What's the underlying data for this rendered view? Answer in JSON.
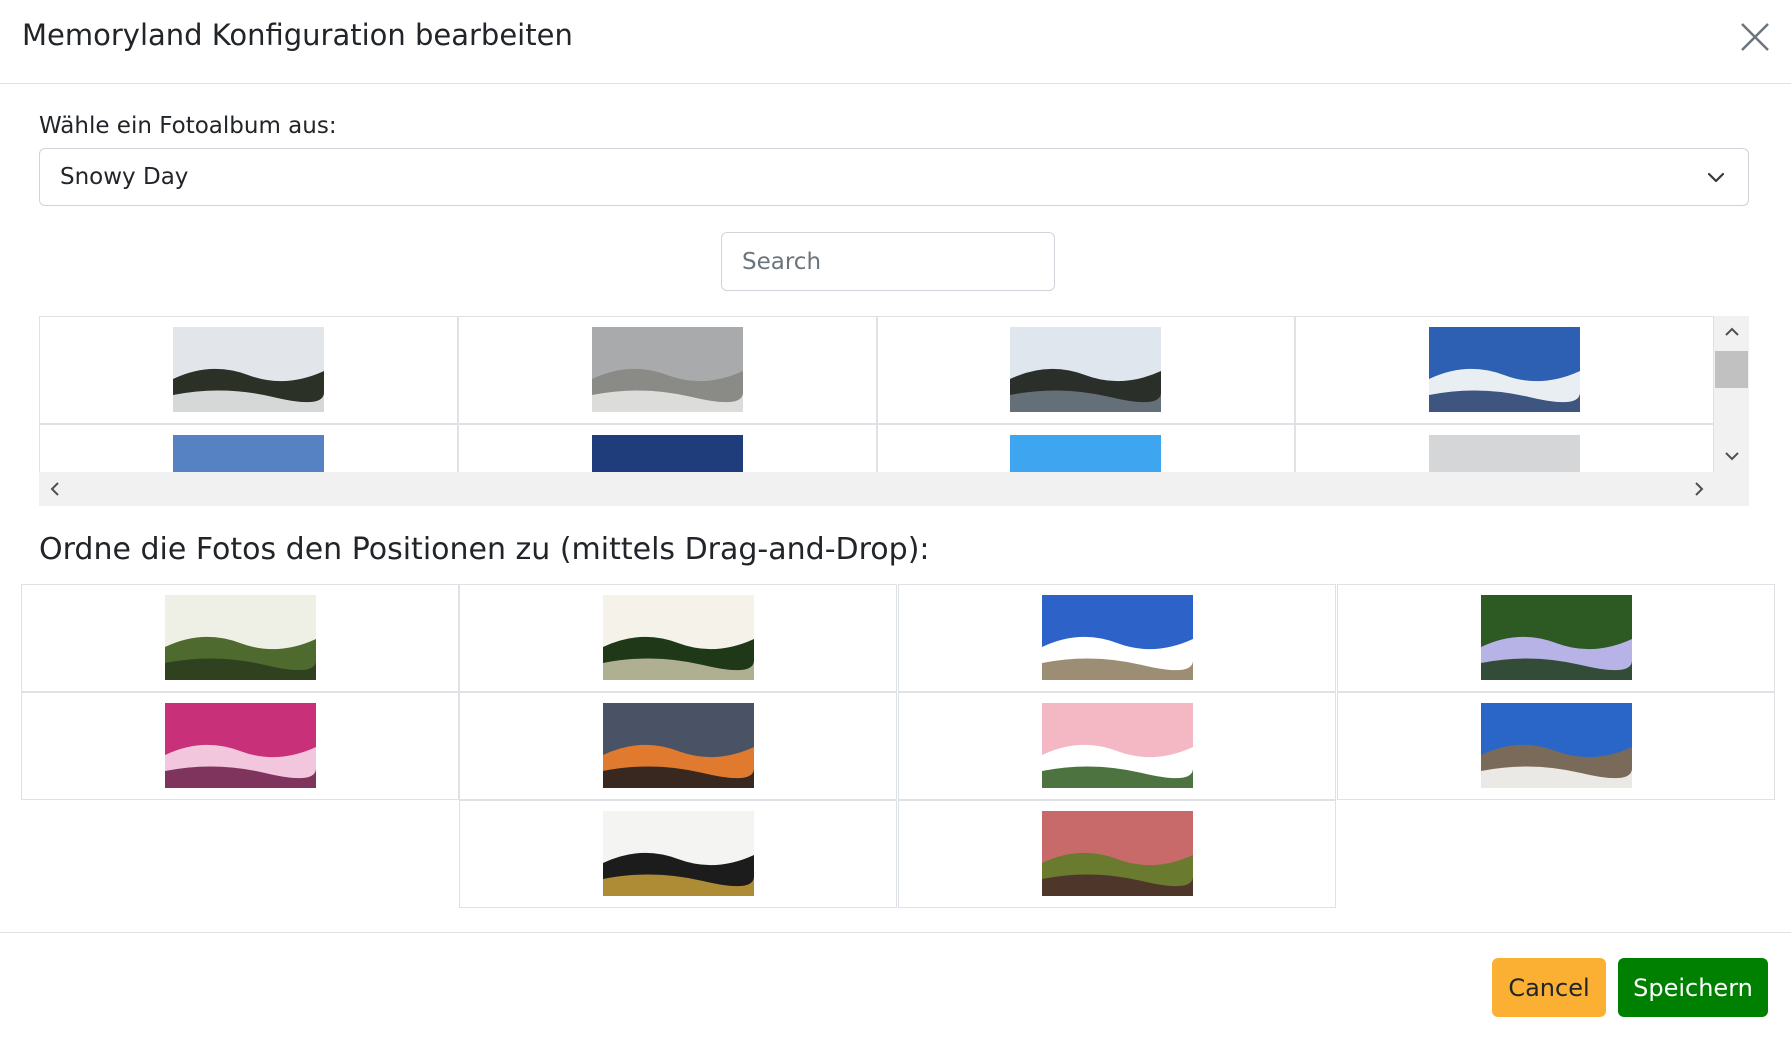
{
  "header": {
    "title": "Memoryland Konfiguration bearbeiten",
    "close_icon": "close-icon"
  },
  "album": {
    "label": "Wähle ein Fotoalbum aus:",
    "selected": "Snowy Day",
    "options": [
      "Snowy Day"
    ]
  },
  "search": {
    "placeholder": "Search",
    "value": ""
  },
  "album_photos": [
    {
      "icon": "snowy-trees-photo",
      "colors": [
        "#e2e6ea",
        "#2c3128",
        "#f4f5f6"
      ]
    },
    {
      "icon": "foggy-snowfield-photo",
      "colors": [
        "#a9aaab",
        "#8a8a86",
        "#eaeaea"
      ]
    },
    {
      "icon": "mountain-valley-photo",
      "colors": [
        "#dfe6ee",
        "#2b2f2a",
        "#6f7a86"
      ]
    },
    {
      "icon": "snowy-mountain-ridge-photo",
      "colors": [
        "#2d5fb3",
        "#e9eef3",
        "#1e3a6a"
      ]
    },
    {
      "icon": "sun-clouds-photo",
      "colors": [
        "#5682c4",
        "#ffffff",
        "#2a4d8c"
      ]
    },
    {
      "icon": "sunset-dark-sky-photo",
      "colors": [
        "#1e3d7a",
        "#0e1a33",
        "#ffffff"
      ]
    },
    {
      "icon": "clear-blue-sky-photo",
      "colors": [
        "#3ea6f0",
        "#7cc5f8",
        "#2c8ee0"
      ]
    },
    {
      "icon": "snowy-hilltop-photo",
      "colors": [
        "#d4d6d8",
        "#6e7377",
        "#2d2f2f"
      ]
    }
  ],
  "positions_heading": "Ordne die Fotos den Positionen zu (mittels Drag-and-Drop):",
  "position_photos": [
    {
      "icon": "white-blossoms-photo",
      "colors": [
        "#eef0e6",
        "#4e6a2e",
        "#2b3a1c"
      ]
    },
    {
      "icon": "white-flower-cluster-photo",
      "colors": [
        "#f5f2ea",
        "#1f3818",
        "#c9c4a8"
      ]
    },
    {
      "icon": "clouds-over-town-photo",
      "colors": [
        "#2d63c9",
        "#ffffff",
        "#8a7a5c"
      ]
    },
    {
      "icon": "purple-hydrangea-photo",
      "colors": [
        "#2c5a22",
        "#b8b3e6",
        "#1a3a18"
      ]
    },
    {
      "icon": "pink-peony-photo",
      "colors": [
        "#c8307a",
        "#f2c6dc",
        "#6b1a48"
      ]
    },
    {
      "icon": "orange-sunset-photo",
      "colors": [
        "#4a5266",
        "#e07a2e",
        "#1a1a1c"
      ]
    },
    {
      "icon": "pink-roses-photo",
      "colors": [
        "#f3b8c4",
        "#ffffff",
        "#2e5a1e"
      ]
    },
    {
      "icon": "old-town-view-photo",
      "colors": [
        "#2a66c7",
        "#7a6a5a",
        "#ffffff"
      ]
    },
    {
      "icon": "white-rose-photo",
      "colors": [
        "#f4f4f2",
        "#1c1c1c",
        "#c7a03a"
      ]
    },
    {
      "icon": "succulent-rosette-photo",
      "colors": [
        "#c96a6a",
        "#6a7a2e",
        "#4a2a2a"
      ]
    }
  ],
  "footer": {
    "cancel_label": "Cancel",
    "save_label": "Speichern"
  },
  "colors": {
    "cancel": "#fbb034",
    "save": "#008000",
    "border": "#dee2e6"
  }
}
